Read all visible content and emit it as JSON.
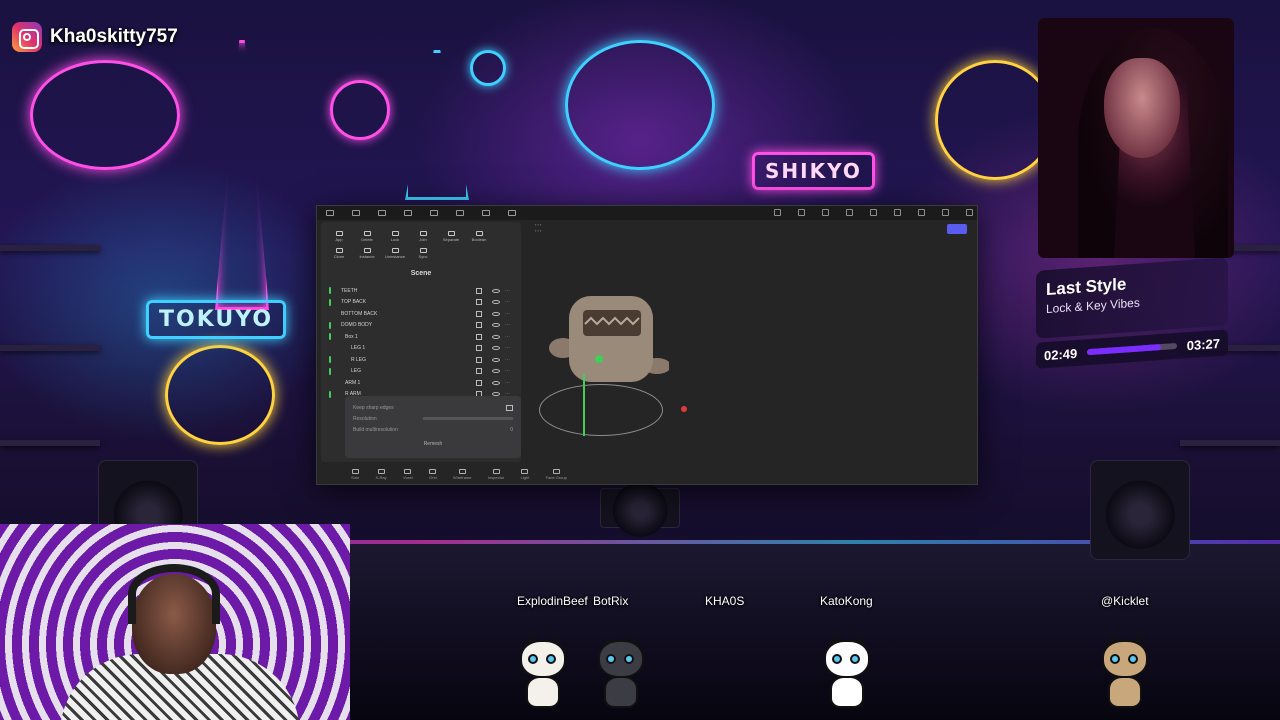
{
  "stream": {
    "social_handle": "Kha0skitty757"
  },
  "neon_signs": {
    "left_sign": "TOKUYO",
    "center_sign": "SHIKYO"
  },
  "app": {
    "scene_title": "Scene",
    "toolbar": [
      "App",
      "Delete",
      "Lock",
      "Join",
      "Separate",
      "Boolean",
      "Clone",
      "Instance",
      "Uninstance",
      "Sync"
    ],
    "hierarchy": [
      {
        "label": "TEETH",
        "value": ""
      },
      {
        "label": "TOP BACK",
        "value": ""
      },
      {
        "label": "BOTTOM BACK",
        "value": ""
      },
      {
        "label": "DOMO BODY",
        "value": ""
      },
      {
        "label": "Box 1",
        "value": ""
      },
      {
        "label": "LEG 1",
        "value": ""
      },
      {
        "label": "R LEG",
        "value": ""
      },
      {
        "label": "LEG",
        "value": ""
      },
      {
        "label": "ARM 1",
        "value": ""
      },
      {
        "label": "R ARM",
        "value": ""
      }
    ],
    "remesh_panel": {
      "keep_sharp": "Keep sharp edges",
      "resolution_label": "Resolution",
      "multires_label": "Build multiresolution",
      "multires_value": "0",
      "remesh_button": "Remesh"
    },
    "bottom_tools": [
      "Solo",
      "X-Ray",
      "Voxel",
      "Grid",
      "Wireframe",
      "Inspector",
      "Light",
      "Face Group"
    ]
  },
  "music_widget": {
    "title": "Last Style",
    "artist": "Lock & Key Vibes",
    "elapsed": "02:49",
    "duration": "03:27",
    "progress": 0.82,
    "accent_color": "#7b2cff"
  },
  "viewers": [
    {
      "name": "ExplodinBeef"
    },
    {
      "name": "BotRix"
    },
    {
      "name": "KHA0S"
    },
    {
      "name": "KatoKong"
    },
    {
      "name": "@Kicklet"
    }
  ]
}
